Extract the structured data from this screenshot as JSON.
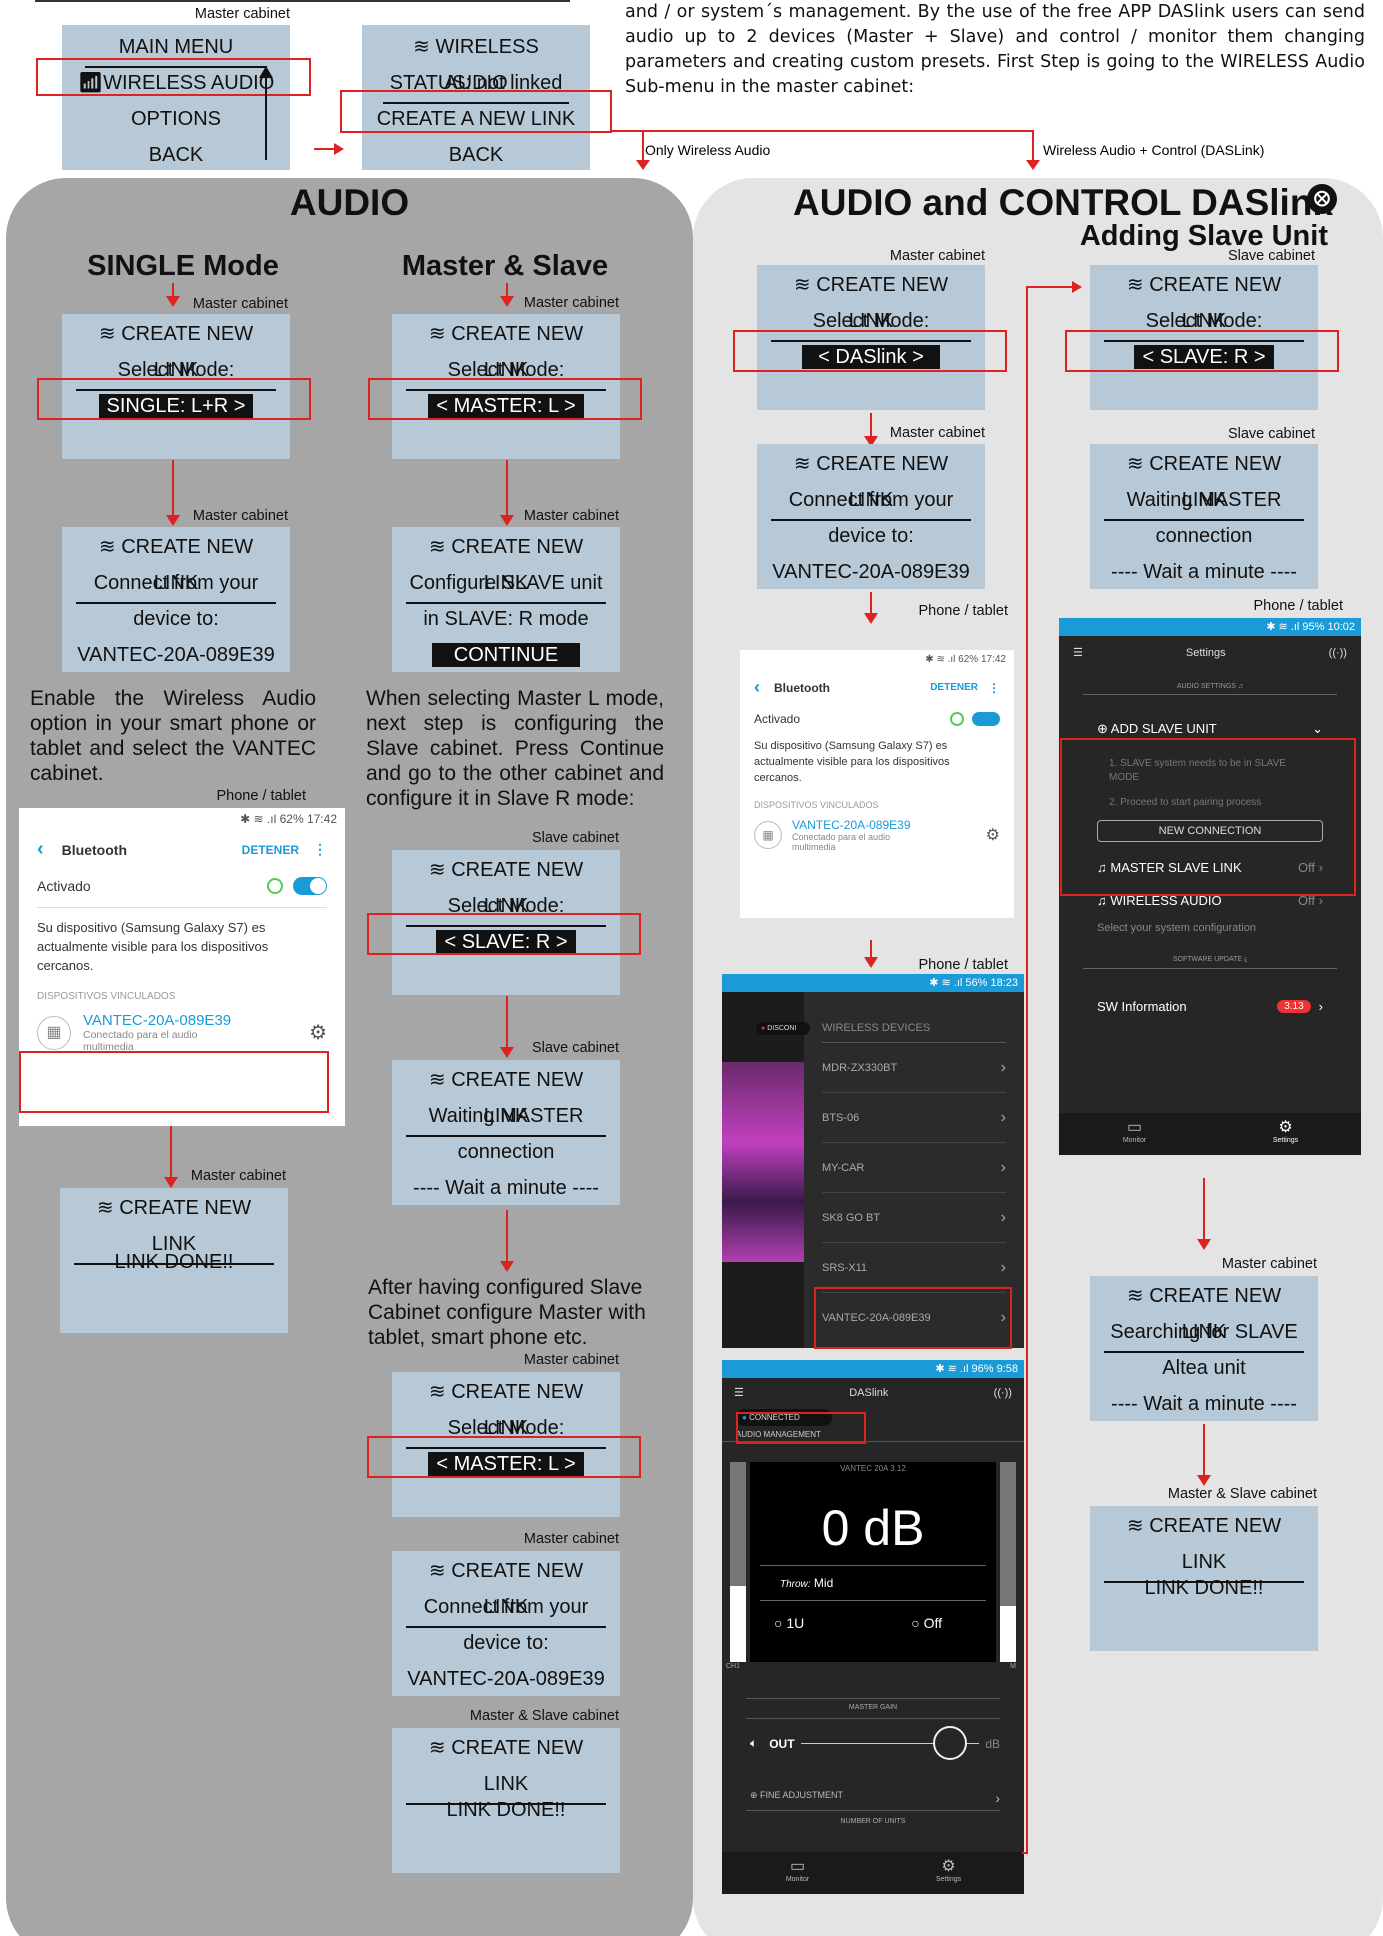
{
  "intro_text": "and / or system´s management. By the use of the free APP DASlink users can send audio up to 2 devices (Master + Slave) and control / monitor them changing parameters and creating custom presets. First Step is going to the WIRELESS Audio Sub-menu in the master cabinet:",
  "top": {
    "master_label": "Master cabinet",
    "menu1": [
      "MAIN MENU",
      "WIRELESS AUDIO",
      "OPTIONS",
      "BACK"
    ],
    "menu2": [
      "WIRELESS AUDIO",
      "STATUS: not linked",
      "CREATE A NEW LINK",
      "BACK"
    ],
    "only_wireless": "Only Wireless Audio",
    "wireless_control": "Wireless Audio + Control (DASLink)"
  },
  "audio": {
    "title": "AUDIO",
    "single": {
      "heading": "SINGLE Mode",
      "lcd1_label": "Master cabinet",
      "lcd1": [
        "CREATE NEW LINK",
        "Select Mode:",
        "SINGLE: L+R >"
      ],
      "lcd2_label": "Master cabinet",
      "lcd2": [
        "CREATE NEW LINK",
        "Connect from your",
        "device to:",
        "VANTEC-20A-089E39"
      ],
      "para": "Enable the Wireless Audio option in your smart phone or tablet and select the VANTEC cabinet.",
      "phone_label": "Phone / tablet",
      "lcd3_label": "Master cabinet",
      "lcd3": [
        "CREATE NEW LINK",
        "LINK DONE!!"
      ]
    },
    "ms": {
      "heading": "Master & Slave",
      "lcd1_label": "Master cabinet",
      "lcd1": [
        "CREATE NEW LINK",
        "Select Mode:",
        "< MASTER: L >"
      ],
      "lcd2_label": "Master cabinet",
      "lcd2": [
        "CREATE NEW LINK",
        "Configure SLAVE unit",
        "in SLAVE: R mode",
        "CONTINUE"
      ],
      "para1": "When selecting Master L mode, next step is configuring the Slave cabinet. Press Continue and go to the other cabinet and configure it in Slave R mode:",
      "lcd3_label": "Slave cabinet",
      "lcd3": [
        "CREATE NEW LINK",
        "Select Mode:",
        "< SLAVE: R >"
      ],
      "lcd4_label": "Slave cabinet",
      "lcd4": [
        "CREATE NEW LINK",
        "Waiting MASTER",
        "connection",
        "---- Wait a minute ----"
      ],
      "para2": "After having configured Slave Cabinet configure Master with tablet, smart phone etc.",
      "lcd5_label": "Master cabinet",
      "lcd5": [
        "CREATE NEW LINK",
        "Select Mode:",
        "< MASTER: L >"
      ],
      "lcd6_label": "Master cabinet",
      "lcd6": [
        "CREATE NEW LINK",
        "Connect from your",
        "device to:",
        "VANTEC-20A-089E39"
      ],
      "lcd7_label": "Master & Slave cabinet",
      "lcd7": [
        "CREATE NEW LINK",
        "LINK DONE!!"
      ]
    }
  },
  "control": {
    "title": "AUDIO and CONTROL DASlink",
    "subtitle": "Adding Slave Unit",
    "lcd1_label": "Master cabinet",
    "lcd1": [
      "CREATE NEW LINK",
      "Select Mode:",
      "< DASlink >"
    ],
    "lcd2_label": "Master cabinet",
    "lcd2": [
      "CREATE NEW LINK",
      "Connect from your",
      "device to:",
      "VANTEC-20A-089E39"
    ],
    "phone1_label": "Phone / tablet",
    "phone2_label": "Phone / tablet",
    "slave1_label": "Slave cabinet",
    "slave1": [
      "CREATE NEW LINK",
      "Select Mode:",
      "< SLAVE: R >"
    ],
    "slave2_label": "Slave cabinet",
    "slave2": [
      "CREATE NEW LINK",
      "Waiting MASTER",
      "connection",
      "---- Wait a minute ----"
    ],
    "phone3_label": "Phone / tablet",
    "lcd3_label": "Master cabinet",
    "lcd3": [
      "CREATE NEW LINK",
      "Searching for SLAVE",
      "Altea unit",
      "---- Wait a minute ----"
    ],
    "lcd4_label": "Master & Slave cabinet",
    "lcd4": [
      "CREATE NEW LINK",
      "LINK DONE!!"
    ]
  },
  "bt": {
    "status": "62% 17:42",
    "title": "Bluetooth",
    "action": "DETENER",
    "activated": "Activado",
    "visible": "Su dispositivo (Samsung Galaxy S7) es actualmente visible para los dispositivos cercanos.",
    "section": "DISPOSITIVOS VINCULADOS",
    "device": "VANTEC-20A-089E39",
    "device_sub": "Conectado para el audio multimedia"
  },
  "wireless_app": {
    "status": "56% 18:23",
    "header": "WIRELESS DEVICES",
    "disconnected": "DISCONI",
    "devices": [
      "MDR-ZX330BT",
      "BTS-06",
      "MY-CAR",
      "SK8 GO BT",
      "SRS-X11",
      "VANTEC-20A-089E39"
    ]
  },
  "monitor_app": {
    "status": "96% 9:58",
    "title": "DASlink",
    "connected": "CONNECTED",
    "section": "AUDIO MANAGEMENT",
    "device": "VANTEC 20A 3.12",
    "level": "0 dB",
    "throw_label": "Throw:",
    "throw_value": "Mid",
    "opt1": "1U",
    "opt2": "Off",
    "ch": "CH1",
    "m": "M",
    "master_gain": "MASTER GAIN",
    "out": "OUT",
    "db": "dB",
    "fine": "FINE ADJUSTMENT",
    "units": "NUMBER OF UNITS",
    "tab1": "Monitor",
    "tab2": "Settings"
  },
  "settings_app": {
    "status": "95% 10:02",
    "title": "Settings",
    "audio_settings": "AUDIO SETTINGS",
    "add_slave": "ADD SLAVE UNIT",
    "step1": "1. SLAVE system needs to be in SLAVE MODE",
    "step2": "2. Proceed to start pairing process",
    "new_connection": "NEW CONNECTION",
    "master_slave": "MASTER SLAVE LINK",
    "master_slave_val": "Off",
    "wireless_audio": "WIRELESS AUDIO",
    "wireless_audio_val": "Off",
    "select_config": "Select your system configuration",
    "software_update": "SOFTWARE UPDATE",
    "sw_info": "SW Information",
    "sw_badge": "3.13",
    "tab1": "Monitor",
    "tab2": "Settings"
  },
  "colors": {
    "accent": "#d22222",
    "lcd": "#b7c9d6",
    "panel_left": "#a6a6a6",
    "panel_right": "#e4e4e4",
    "app_blue": "#1a9bd7"
  }
}
